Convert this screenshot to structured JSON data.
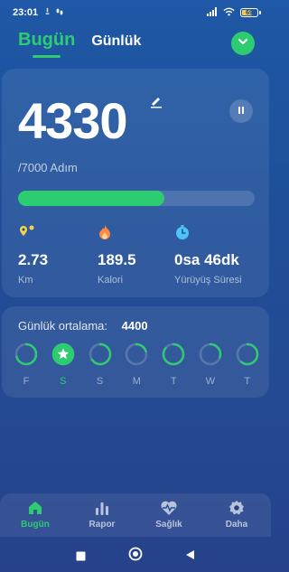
{
  "status_bar": {
    "time": "23:01",
    "battery": "69"
  },
  "tabs": [
    {
      "label": "Bugün",
      "active": true
    },
    {
      "label": "Günlük",
      "active": false
    }
  ],
  "summary": {
    "steps": "4330",
    "goal_text": "/7000 Adım",
    "progress_fraction": 0.62
  },
  "stats": [
    {
      "icon": "location-pin-icon",
      "value": "2.73",
      "label": "Km",
      "color": "#f5d547"
    },
    {
      "icon": "flame-icon",
      "value": "189.5",
      "label": "Kalori",
      "color": "#ff8a3d"
    },
    {
      "icon": "stopwatch-icon",
      "value": "0sa 46dk",
      "label": "Yürüyüş Süresi",
      "color": "#4fc3f7"
    }
  ],
  "daily_average": {
    "label": "Günlük ortalama:",
    "value": "4400",
    "days": [
      {
        "label": "F",
        "progress": 0.7,
        "selected": false
      },
      {
        "label": "S",
        "progress": 1.0,
        "selected": true
      },
      {
        "label": "S",
        "progress": 0.65,
        "selected": false
      },
      {
        "label": "M",
        "progress": 0.2,
        "selected": false
      },
      {
        "label": "T",
        "progress": 0.85,
        "selected": false
      },
      {
        "label": "W",
        "progress": 0.3,
        "selected": false
      },
      {
        "label": "T",
        "progress": 0.6,
        "selected": false
      }
    ]
  },
  "bottom_nav": [
    {
      "label": "Bugün",
      "icon": "home-icon",
      "active": true
    },
    {
      "label": "Rapor",
      "icon": "bar-chart-icon",
      "active": false
    },
    {
      "label": "Sağlık",
      "icon": "heart-pulse-icon",
      "active": false
    },
    {
      "label": "Daha",
      "icon": "gear-icon",
      "active": false
    }
  ],
  "colors": {
    "accent": "#2ecc71",
    "background": "#1f4f99"
  }
}
